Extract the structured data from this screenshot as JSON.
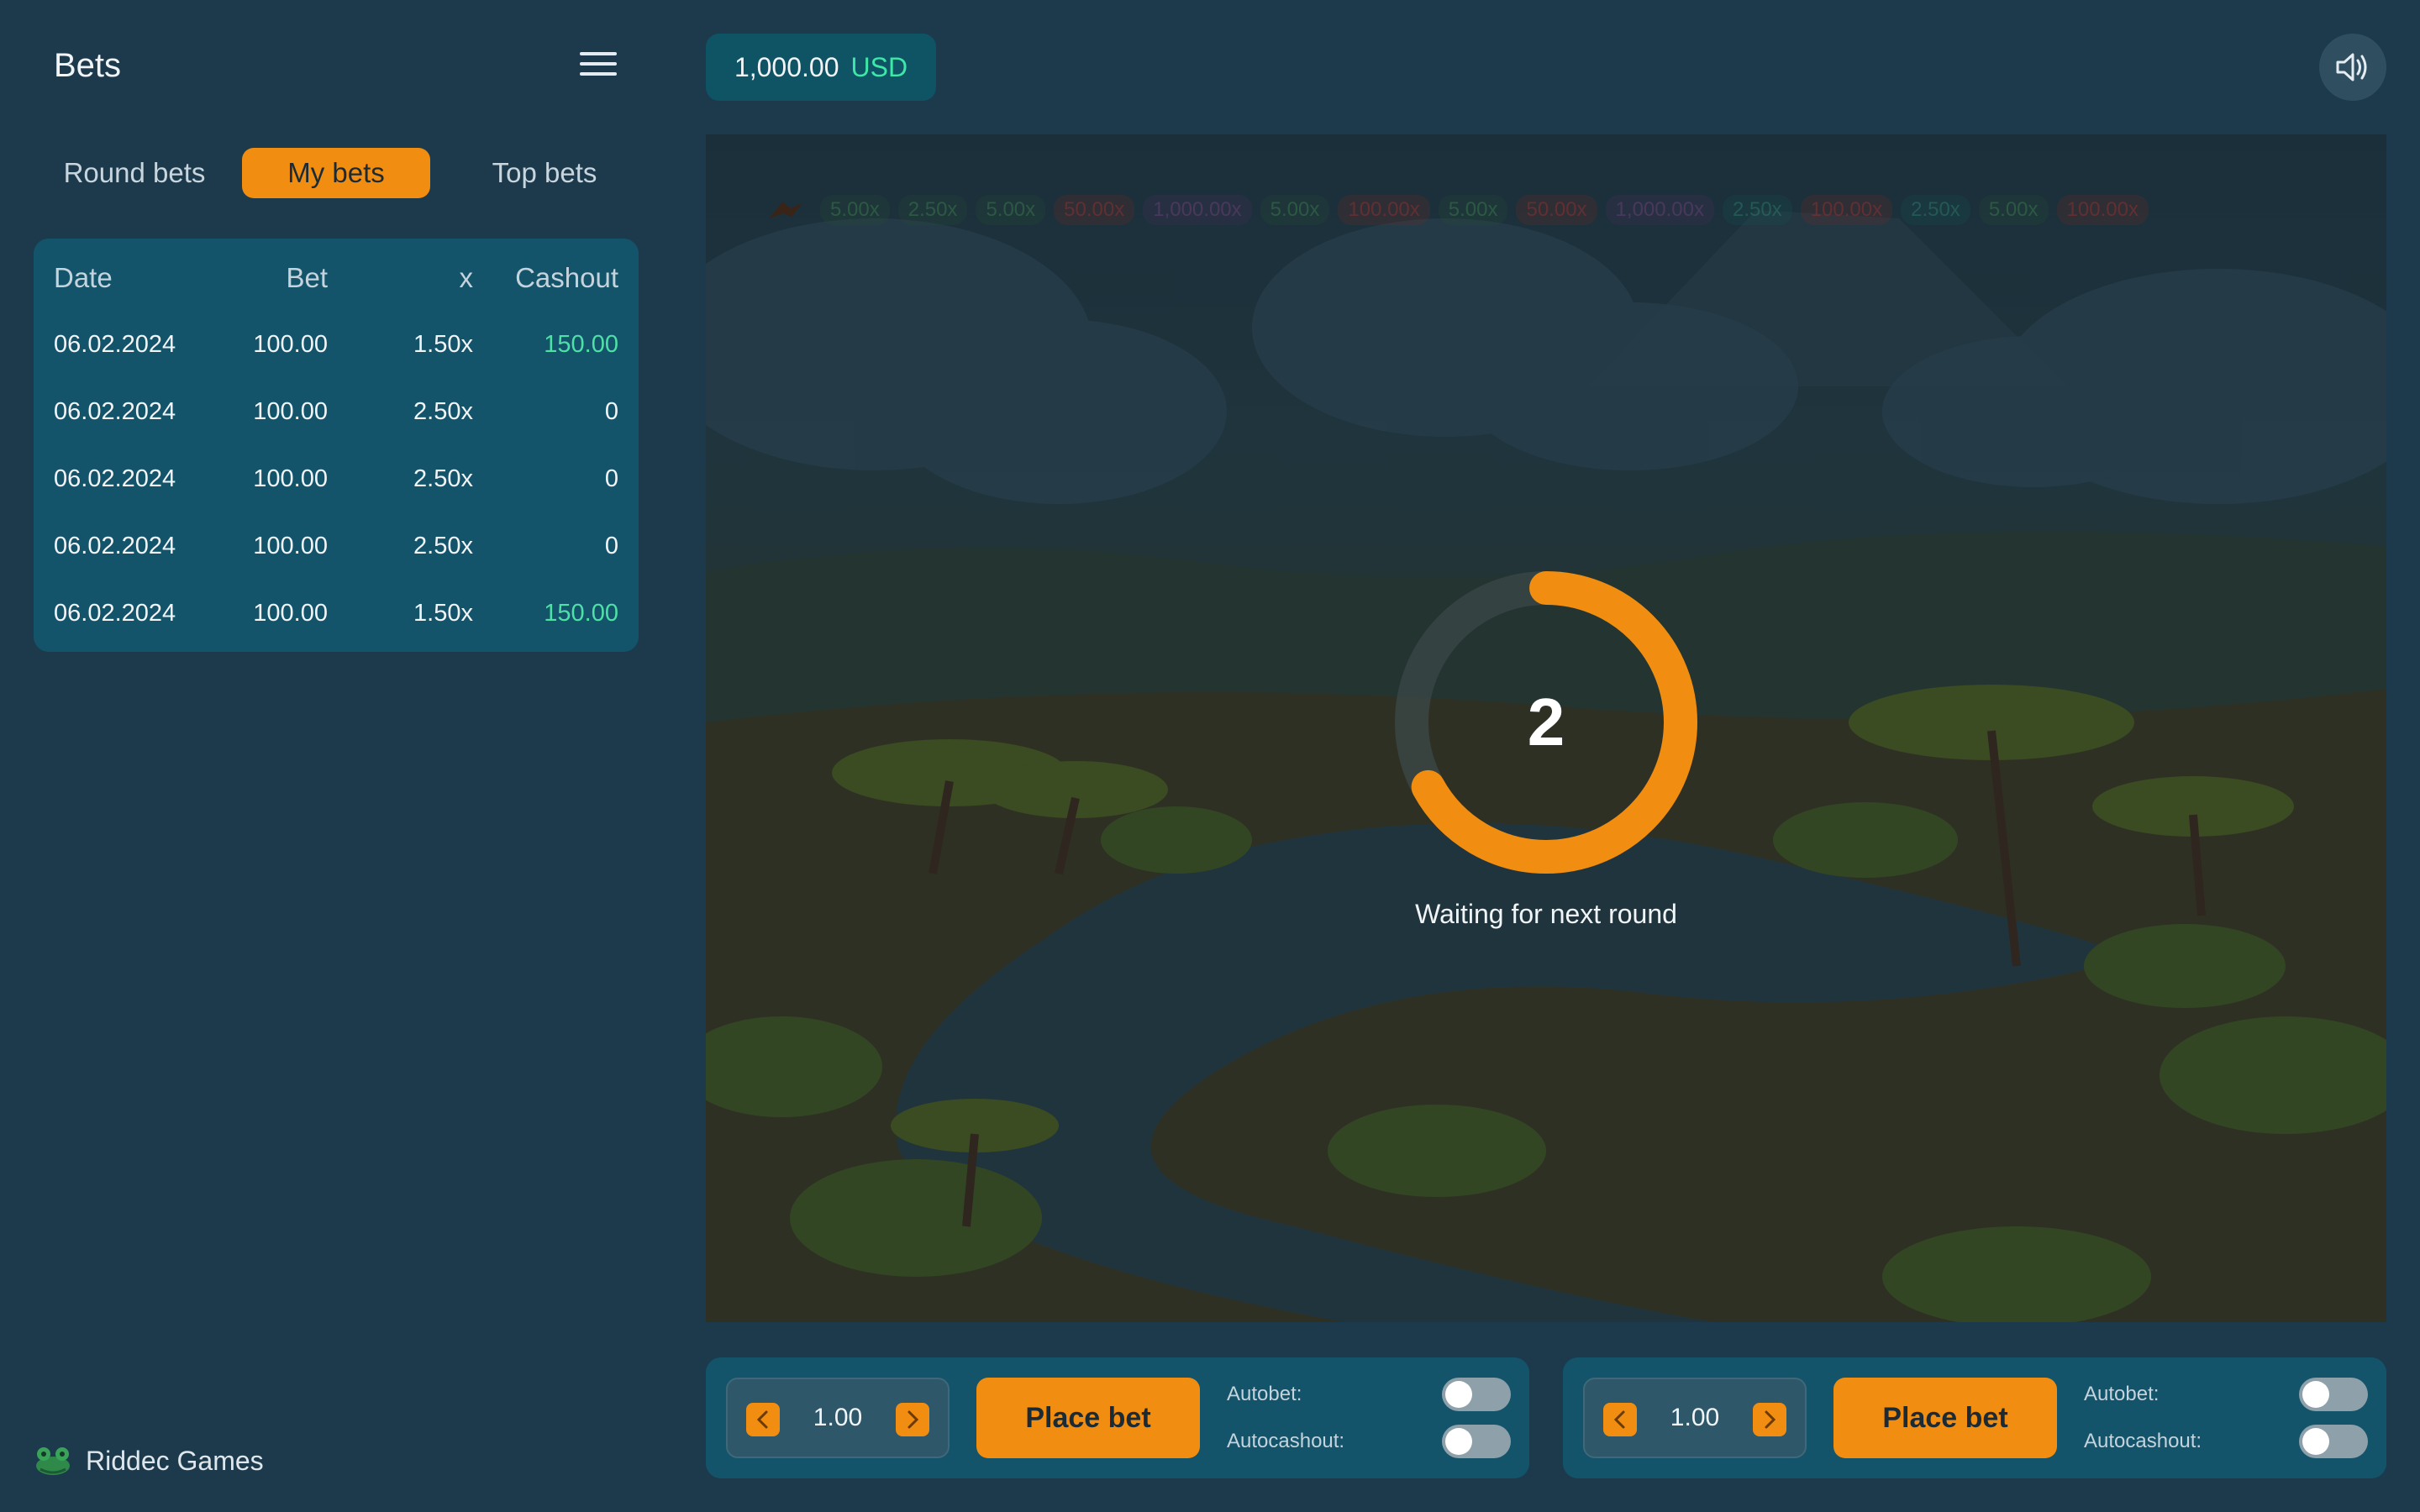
{
  "sidebar": {
    "title": "Bets",
    "tabs": [
      "Round bets",
      "My bets",
      "Top bets"
    ],
    "active_tab": "My bets",
    "table": {
      "headers": [
        "Date",
        "Bet",
        "x",
        "Cashout"
      ],
      "rows": [
        {
          "date": "06.02.2024",
          "bet": "100.00",
          "x": "1.50x",
          "cashout": "150.00"
        },
        {
          "date": "06.02.2024",
          "bet": "100.00",
          "x": "2.50x",
          "cashout": "0"
        },
        {
          "date": "06.02.2024",
          "bet": "100.00",
          "x": "2.50x",
          "cashout": "0"
        },
        {
          "date": "06.02.2024",
          "bet": "100.00",
          "x": "2.50x",
          "cashout": "0"
        },
        {
          "date": "06.02.2024",
          "bet": "100.00",
          "x": "1.50x",
          "cashout": "150.00"
        }
      ]
    },
    "brand": "Riddec Games"
  },
  "header": {
    "balance_amount": "1,000.00",
    "balance_currency": "USD"
  },
  "game": {
    "history": [
      "5.00x",
      "2.50x",
      "5.00x",
      "50.00x",
      "1,000.00x",
      "5.00x",
      "100.00x",
      "5.00x",
      "50.00x",
      "1,000.00x",
      "2.50x",
      "100.00x",
      "2.50x",
      "5.00x",
      "100.00x"
    ],
    "countdown": "2",
    "countdown_progress": 0.67,
    "status": "Waiting for next round"
  },
  "bet_panels": [
    {
      "amount": "1.00",
      "place_label": "Place bet",
      "autobet_label": "Autobet:",
      "autocashout_label": "Autocashout:",
      "autobet_on": false,
      "autocashout_on": false
    },
    {
      "amount": "1.00",
      "place_label": "Place bet",
      "autobet_label": "Autobet:",
      "autocashout_label": "Autocashout:",
      "autobet_on": false,
      "autocashout_on": false
    }
  ],
  "colors": {
    "accent": "#f18d10",
    "background": "#1d3a4c",
    "panel": "#13546b",
    "positive": "#4fe0a6"
  },
  "icons": {
    "menu": "hamburger-menu-icon",
    "sound": "speaker-icon",
    "brand": "frog-logo-icon",
    "step_down": "chevron-left-icon",
    "step_up": "chevron-right-icon"
  }
}
